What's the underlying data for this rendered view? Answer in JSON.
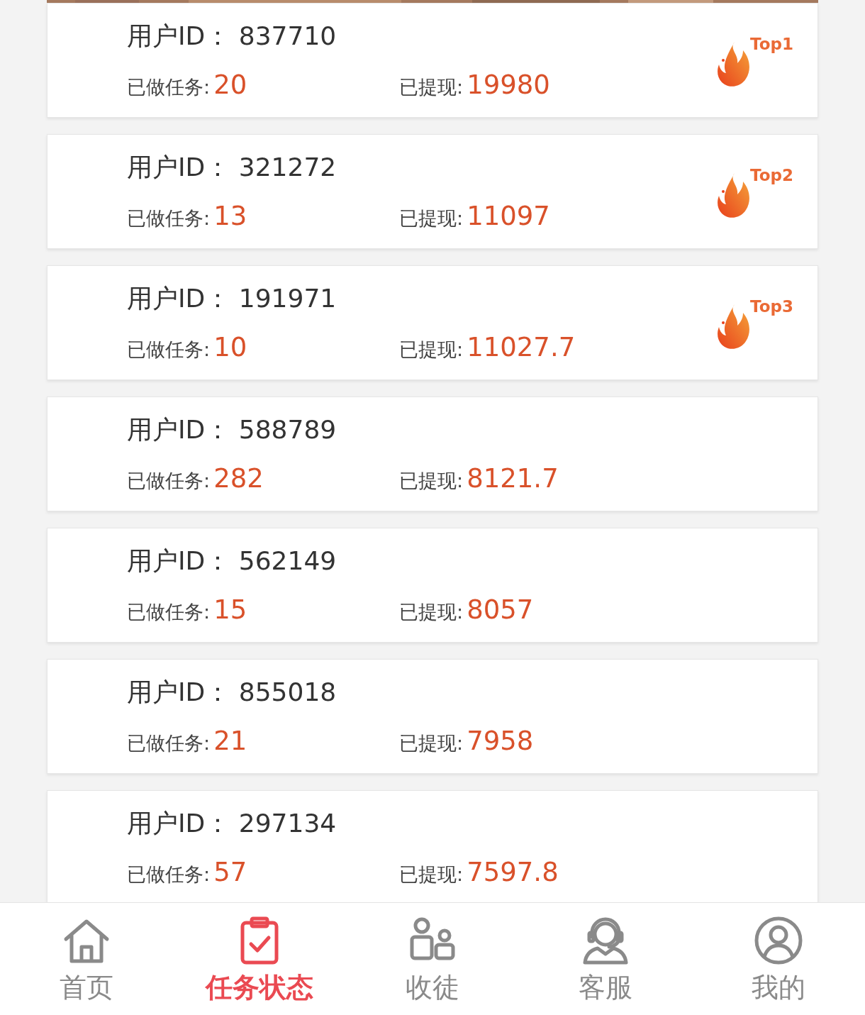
{
  "ranking": [
    {
      "user_id_label": "用户ID：",
      "user_id": "837710",
      "tasks_label": "已做任务:",
      "tasks": "20",
      "withdrawn_label": "已提现:",
      "withdrawn": "19980",
      "badge": "Top1"
    },
    {
      "user_id_label": "用户ID：",
      "user_id": "321272",
      "tasks_label": "已做任务:",
      "tasks": "13",
      "withdrawn_label": "已提现:",
      "withdrawn": "11097",
      "badge": "Top2"
    },
    {
      "user_id_label": "用户ID：",
      "user_id": "191971",
      "tasks_label": "已做任务:",
      "tasks": "10",
      "withdrawn_label": "已提现:",
      "withdrawn": "11027.7",
      "badge": "Top3"
    },
    {
      "user_id_label": "用户ID：",
      "user_id": "588789",
      "tasks_label": "已做任务:",
      "tasks": "282",
      "withdrawn_label": "已提现:",
      "withdrawn": "8121.7"
    },
    {
      "user_id_label": "用户ID：",
      "user_id": "562149",
      "tasks_label": "已做任务:",
      "tasks": "15",
      "withdrawn_label": "已提现:",
      "withdrawn": "8057"
    },
    {
      "user_id_label": "用户ID：",
      "user_id": "855018",
      "tasks_label": "已做任务:",
      "tasks": "21",
      "withdrawn_label": "已提现:",
      "withdrawn": "7958"
    },
    {
      "user_id_label": "用户ID：",
      "user_id": "297134",
      "tasks_label": "已做任务:",
      "tasks": "57",
      "withdrawn_label": "已提现:",
      "withdrawn": "7597.8"
    }
  ],
  "tab_bar": [
    {
      "kind": "home",
      "label": "首页",
      "selected": false
    },
    {
      "kind": "tasks",
      "label": "任务状态",
      "selected": true
    },
    {
      "kind": "people",
      "label": "收徒",
      "selected": false
    },
    {
      "kind": "support",
      "label": "客服",
      "selected": false
    },
    {
      "kind": "profile",
      "label": "我的",
      "selected": false
    }
  ]
}
